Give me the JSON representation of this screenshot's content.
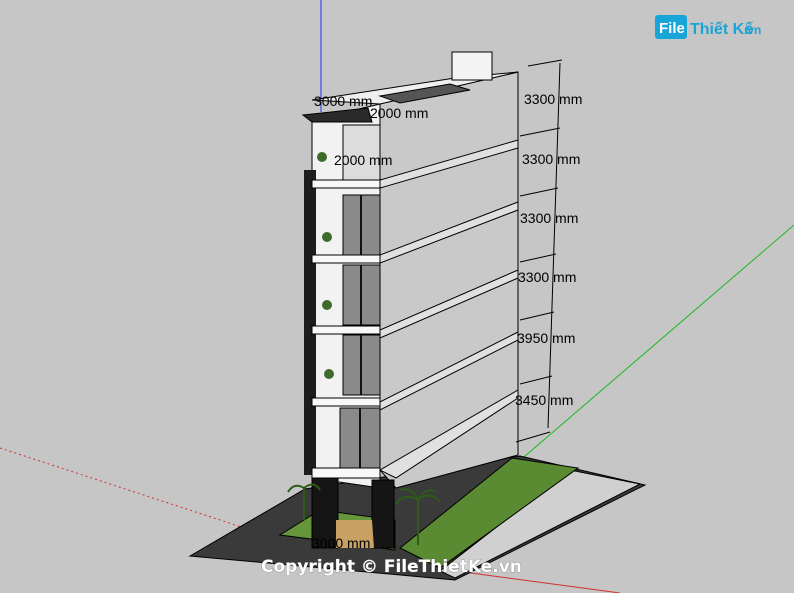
{
  "viewport": {
    "background": "#c6c6c6",
    "axis_colors": {
      "blue": "#2a2aff",
      "green": "#1fb81f",
      "red": "#d03030"
    }
  },
  "watermark": {
    "logo_box_text": "File",
    "logo_rest_text": "Thiết Kế",
    "logo_suffix": ".vn",
    "copyright": "Copyright © FileThietKe.vn",
    "logo_color": "#18a5d8"
  },
  "dimensions": {
    "floor_heights": [
      "3300 mm",
      "3300 mm",
      "3300 mm",
      "3300 mm",
      "3950 mm",
      "3450 mm"
    ],
    "roof_front": "3000 mm",
    "roof_side": "2000 mm",
    "front_second": "2000 mm",
    "ground_front": "3000 mm"
  }
}
